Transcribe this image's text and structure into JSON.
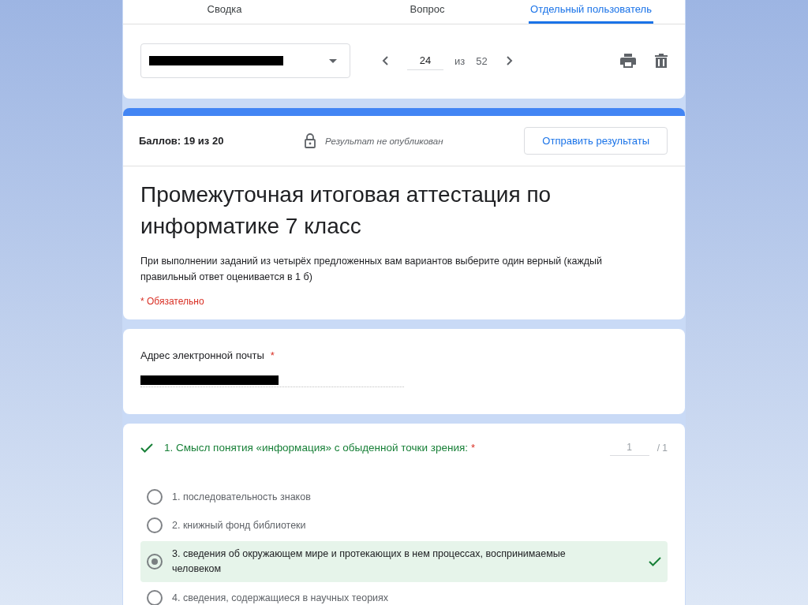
{
  "tabs": [
    {
      "label": "Сводка",
      "selected": false
    },
    {
      "label": "Вопрос",
      "selected": false
    },
    {
      "label": "Отдельный пользователь",
      "selected": true
    }
  ],
  "pager": {
    "current": "24",
    "separator": "из",
    "total": "52"
  },
  "score": {
    "label": "Баллов: 19 из 20",
    "status": "Результат не опубликован",
    "button": "Отправить результаты"
  },
  "form": {
    "title": "Промежуточная итоговая аттестация по информатике 7 класс",
    "description": "При выполнении заданий  из четырёх предложенных вам вариантов выберите один верный (каждый правильный ответ оценивается в 1 б)",
    "required_note": "* Обязательно"
  },
  "email": {
    "label": "Адрес электронной почты",
    "required_mark": "*"
  },
  "questions": [
    {
      "correct": true,
      "text": "1. Смысл понятия «информация» с обыденной точки зрения:",
      "required_mark": "*",
      "points": "1",
      "max_points": "/ 1",
      "options": [
        {
          "text": "1. последовательность знаков",
          "selected": false
        },
        {
          "text": "2. книжный фонд библиотеки",
          "selected": false
        },
        {
          "text": "3. сведения об окружающем мире и протекающих в нем процессах, воспринимаемые человеком",
          "selected": true
        },
        {
          "text": "4. сведения, содержащиеся в научных теориях",
          "selected": false
        }
      ]
    }
  ]
}
